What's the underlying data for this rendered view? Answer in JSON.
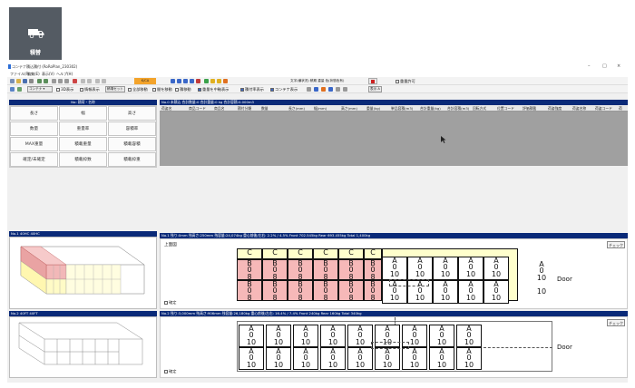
{
  "app_tile": {
    "label": "積替"
  },
  "window": {
    "title": "コンテナ積込積付 (RoRoPlan_230302)",
    "menu": [
      "ファイル(F)",
      "編集(E)",
      "表示(V)",
      "ヘルプ(H)"
    ],
    "controls": [
      "–",
      "□",
      "×"
    ]
  },
  "toolbar": {
    "orange_label": "K/CA",
    "dropdown": "コンテナ",
    "chk_3d": "3D表示",
    "chk_info": "情報表示",
    "btn_manual": "積場セット",
    "chk_all": "全部移動",
    "chk_move_left": "間を移動",
    "chk_move": "積移動",
    "chk_heavy": "重量を中軸表示",
    "chk_rate": "積付率表示",
    "chk_count": "コンテナ表示",
    "text_right": "文字(横状況) 積期 重量 色(状態色有)",
    "chk_exit": "重量許可",
    "btn_show": "表示 A"
  },
  "left_buttons_header": "No: 積荷・名称",
  "left_buttons": [
    "長さ",
    "幅",
    "高さ",
    "数量",
    "重量率",
    "容積率",
    "MAX重量",
    "積載重量",
    "積載容積",
    "確定/未確定",
    "積載枠数",
    "積載枠重"
  ],
  "container1_header": "No.1  40HC  40HC",
  "container2_header": "No.2  40FT  40FT",
  "table_header_title": "No.0  未積込 合計数量:0 合計重量:0 kg 合計容積:0.000m3",
  "table_columns": [
    "荷姿名",
    "商品コード",
    "商品名",
    "積付分類",
    "数量",
    "長さ(mm)",
    "幅(mm)",
    "高さ(mm)",
    "重量(kg)",
    "単品容積(m3)",
    "合計重量(kg)",
    "合計容積(m3)",
    "回転方式",
    "位置コード",
    "評価積載",
    "荷姿強度",
    "荷姿名称",
    "荷姿コード",
    "荷"
  ],
  "panel1": {
    "header": "No.1  残り:0mm  残高さ:250mm  残容量:24,074kg  重心前後/左右: 2.2% / 4.5%        Front  702.545kg  Rear  693.455kg  Total  1,400kg",
    "view_label": "上面図",
    "check_button": "チェック",
    "confirm": "確定",
    "door": "Door",
    "yellow_letter": "C",
    "pink_letter": "B",
    "pink_value": "0",
    "pink_number": "8",
    "white_letter": "A",
    "white_value": "0",
    "white_number": "10"
  },
  "panel2": {
    "header": "No.2  残り:3,000mm  残高さ:906mm  残容量:26,180kg  重心前後/左右: 16.4% / 7.4%        Front  240kg  Rear  160kg  Total  340kg",
    "check_button": "チェック",
    "confirm": "確定",
    "door": "Door",
    "letter": "A",
    "value": "0",
    "number": "10"
  },
  "colors": {
    "navy": "#0a2a78",
    "yellow": "#ffffcc",
    "pink": "#f6b8b8",
    "gray": "#a0a0a0",
    "tile": "#545b63"
  },
  "icons": [
    "truck-icon",
    "new-icon",
    "open-icon",
    "save-icon",
    "print-icon",
    "undo-icon",
    "redo-icon",
    "cursor-icon"
  ]
}
